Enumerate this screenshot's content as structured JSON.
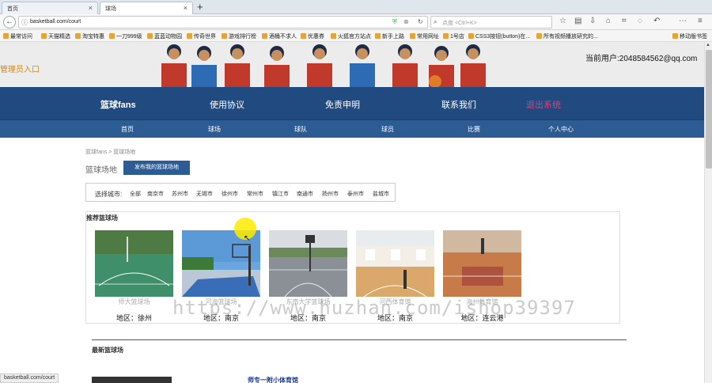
{
  "browser": {
    "tabs": [
      {
        "title": "首页"
      },
      {
        "title": "球场"
      }
    ],
    "url": "basketball.com/court",
    "search_placeholder": "点度 <Ctrl+K>",
    "bookmarks": [
      "最常访问",
      "天猫精选",
      "淘宝特惠",
      "一刀999级",
      "蓝蓝动物园",
      "传奇世界",
      "游戏排行榜",
      "酒桶不求人",
      "优惠券",
      "火狐官方站点",
      "新手上路",
      "常用网址",
      "1号店",
      "CSS3按钮(button)在...",
      "所有视频播放研究的..."
    ],
    "bookmark_right": "移动版书签",
    "status_url": "basketball.com/court"
  },
  "header": {
    "admin_link": "管理员入口",
    "user_info": "当前用户:2048584562@qq.com"
  },
  "main_nav": {
    "brand": "篮球fans",
    "items": [
      "使用协议",
      "免责申明",
      "联系我们"
    ],
    "logout": "退出系统"
  },
  "sub_nav": [
    "首页",
    "球场",
    "球队",
    "球员",
    "比赛",
    "个人中心"
  ],
  "breadcrumb": "篮球fans > 篮球场地",
  "section_title": "篮球场地",
  "publish_button": "发布我的篮球场地",
  "filter": {
    "label": "选择城市:",
    "cities": [
      "全部",
      "南京市",
      "苏州市",
      "无锡市",
      "徐州市",
      "常州市",
      "镇江市",
      "南通市",
      "扬州市",
      "泰州市",
      "盐城市"
    ]
  },
  "recommended": {
    "title": "推荐篮球场",
    "courts": [
      {
        "name": "师大篮球场",
        "area": "地区：徐州"
      },
      {
        "name": "河海篮球场",
        "area": "地区：南京"
      },
      {
        "name": "东南大学篮球场",
        "area": "地区：南京"
      },
      {
        "name": "河西体育馆",
        "area": "地区：南京"
      },
      {
        "name": "海州体育馆",
        "area": "地区：连云港"
      }
    ]
  },
  "newest": {
    "title": "最新篮球场",
    "first_item_title": "师专一附小体育馆"
  },
  "watermark": "https://www.huzhan.com/ishop39397",
  "colors": {
    "nav_primary": "#204a80",
    "nav_secondary": "#2d5c94",
    "logout": "#e0407a",
    "admin_link": "#d08a1f"
  }
}
